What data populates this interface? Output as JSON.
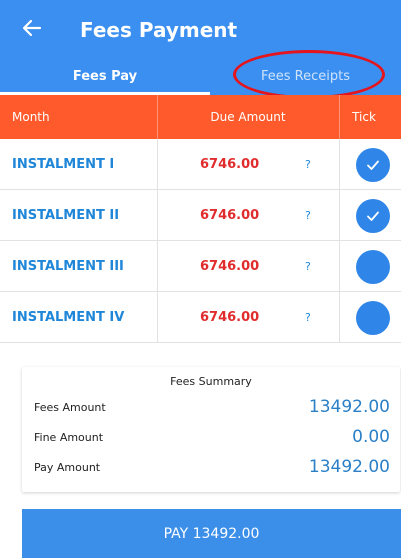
{
  "header": {
    "title": "Fees Payment"
  },
  "tabs": [
    {
      "label": "Fees Pay",
      "active": true
    },
    {
      "label": "Fees Receipts",
      "active": false
    }
  ],
  "table": {
    "headers": {
      "month": "Month",
      "due": "Due Amount",
      "tick": "Tick"
    },
    "rows": [
      {
        "name": "INSTALMENT I",
        "amount": "6746.00",
        "help": "?",
        "checked": true
      },
      {
        "name": "INSTALMENT II",
        "amount": "6746.00",
        "help": "?",
        "checked": true
      },
      {
        "name": "INSTALMENT III",
        "amount": "6746.00",
        "help": "?",
        "checked": false
      },
      {
        "name": "INSTALMENT IV",
        "amount": "6746.00",
        "help": "?",
        "checked": false
      }
    ]
  },
  "summary": {
    "title": "Fees Summary",
    "fees_label": "Fees Amount",
    "fees_value": "13492.00",
    "fine_label": "Fine Amount",
    "fine_value": "0.00",
    "pay_label": "Pay Amount",
    "pay_value": "13492.00"
  },
  "pay_button": "PAY 13492.00",
  "colors": {
    "primary": "#3a8ff0",
    "table_header": "#ff5a2b",
    "amount": "#e02c2c",
    "instalment": "#1f86d8",
    "highlight_ring": "#e5141d"
  }
}
